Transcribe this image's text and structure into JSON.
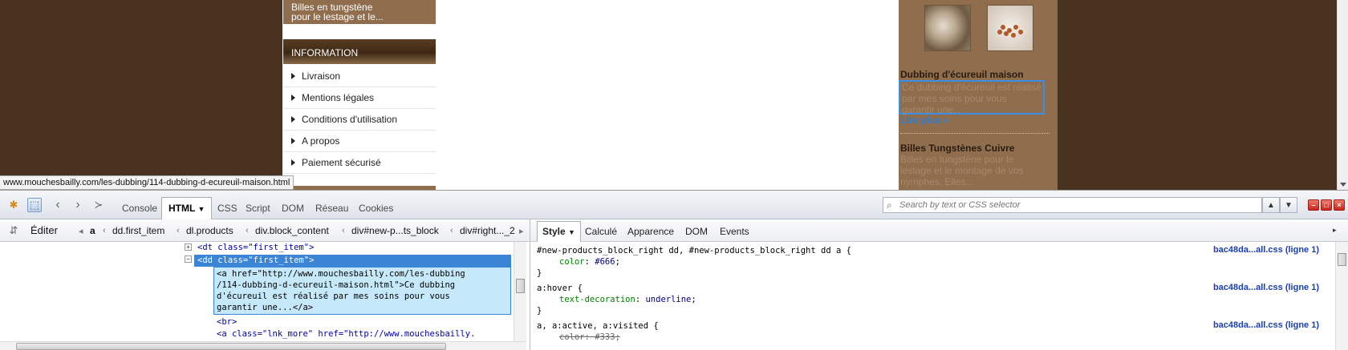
{
  "site": {
    "left": {
      "tungsten_box": "Billes en tungstène\npour le lestage et le...",
      "info_header": "INFORMATION",
      "info_items": [
        "Livraison",
        "Mentions légales",
        "Conditions d'utilisation",
        "A propos",
        "Paiement sécurisé"
      ]
    },
    "right": {
      "product1_title": "Dubbing d'écureuil maison",
      "product1_desc": "Ce dubbing d'écureuil est réalisé par mes soins pour vous garantir une...",
      "read_more": "Lire plus »",
      "product2_title": "Billes Tungstènes Cuivre",
      "product2_desc": "Billes en tungstène pour le lestage et le montage de vos nymphes. Elles..."
    },
    "status_url": "www.mouchesbailly.com/les-dubbing/114-dubbing-d-ecureuil-maison.html"
  },
  "firebug": {
    "tabs": [
      "Console",
      "HTML",
      "CSS",
      "Script",
      "DOM",
      "Réseau",
      "Cookies"
    ],
    "active_tab": "HTML",
    "search_placeholder": "Search by text or CSS selector",
    "edit_label": "Éditer",
    "breadcrumb": [
      "a",
      "dd.first_item",
      "dl.products",
      "div.block_content",
      "div#new-p...ts_block",
      "div#right..._2"
    ],
    "side_tabs": [
      "Style",
      "Calculé",
      "Apparence",
      "DOM",
      "Events"
    ],
    "active_side_tab": "Style",
    "html_tree": {
      "dt_line": "<dt class=\"first_item\">",
      "dd_line": "<dd class=\"first_item\">",
      "a_block": "<a href=\"http://www.mouchesbailly.com/les-dubbing\n/114-dubbing-d-ecureuil-maison.html\">Ce dubbing\nd'écureuil est réalisé par mes soins pour vous\ngarantir une...</a>",
      "br_line": "<br>",
      "last_line": "<a class=\"lnk_more\" href=\"http://www.mouchesbailly."
    },
    "css_rules": {
      "rule1_selector": "#new-products_block_right dd, #new-products_block_right dd a {",
      "rule1_prop": "color",
      "rule1_value": "#666",
      "rule2_selector": "a:hover {",
      "rule2_prop": "text-decoration",
      "rule2_value": "underline",
      "rule3_selector": "a, a:active, a:visited {",
      "rule3_prop": "color",
      "rule3_value": "#333",
      "close": "}",
      "source": "bac48da...all.css (ligne 1)"
    }
  },
  "colors": {
    "site_bg": "#4a3220",
    "panel_brown": "#8f6d4d",
    "selection_blue": "#3c84d6",
    "link_blue": "#2c7ed6"
  }
}
